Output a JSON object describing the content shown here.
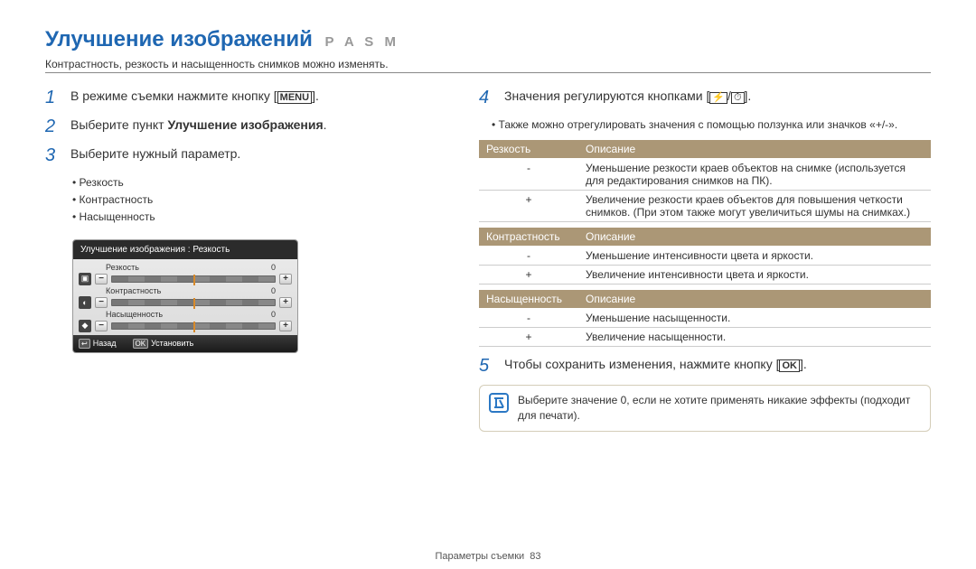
{
  "heading": {
    "title": "Улучшение изображений",
    "modes": "P A S M"
  },
  "subtitle": "Контрастность, резкость и насыщенность снимков можно изменять.",
  "left": {
    "step1_a": "В режиме съемки нажмите кнопку [",
    "step1_menu": "MENU",
    "step1_b": "].",
    "step2_a": "Выберите пункт ",
    "step2_b": "Улучшение изображения",
    "step2_c": ".",
    "step3": "Выберите нужный параметр.",
    "bullets": [
      "Резкость",
      "Контрастность",
      "Насыщенность"
    ]
  },
  "lcd": {
    "title": "Улучшение изображения : Резкость",
    "rows": [
      {
        "label": "Резкость",
        "value": "0"
      },
      {
        "label": "Контрастность",
        "value": "0"
      },
      {
        "label": "Насыщенность",
        "value": "0"
      }
    ],
    "back_icon": "↩",
    "back": "Назад",
    "ok_icon": "OK",
    "set": "Установить"
  },
  "right": {
    "step4_a": "Значения регулируются кнопками [",
    "step4_sep": "/",
    "step4_b": "].",
    "sub1": "Также можно отрегулировать значения с помощью ползунка или значков «+/-».",
    "tables": {
      "t1_h1": "Резкость",
      "t1_h2": "Описание",
      "t1_r1_s": "-",
      "t1_r1_d": "Уменьшение резкости краев объектов на снимке (используется для редактирования снимков на ПК).",
      "t1_r2_s": "+",
      "t1_r2_d": "Увеличение резкости краев объектов для повышения четкости снимков. (При этом также могут увеличиться шумы на снимках.)",
      "t2_h1": "Контрастность",
      "t2_h2": "Описание",
      "t2_r1_s": "-",
      "t2_r1_d": "Уменьшение интенсивности цвета и яркости.",
      "t2_r2_s": "+",
      "t2_r2_d": "Увеличение интенсивности цвета и яркости.",
      "t3_h1": "Насыщенность",
      "t3_h2": "Описание",
      "t3_r1_s": "-",
      "t3_r1_d": "Уменьшение насыщенности.",
      "t3_r2_s": "+",
      "t3_r2_d": "Увеличение насыщенности."
    },
    "step5_a": "Чтобы сохранить изменения, нажмите кнопку [",
    "step5_ok": "OK",
    "step5_b": "].",
    "note": "Выберите значение 0, если не хотите применять никакие эффекты (подходит для печати)."
  },
  "footer": {
    "label": "Параметры съемки",
    "page": "83"
  },
  "nums": {
    "n1": "1",
    "n2": "2",
    "n3": "3",
    "n4": "4",
    "n5": "5"
  },
  "icons": {
    "flash": "⚡",
    "timer": "⏱",
    "sharp": "▣",
    "contrast": "◐",
    "sat": "◆",
    "minus": "−",
    "plus": "+"
  }
}
